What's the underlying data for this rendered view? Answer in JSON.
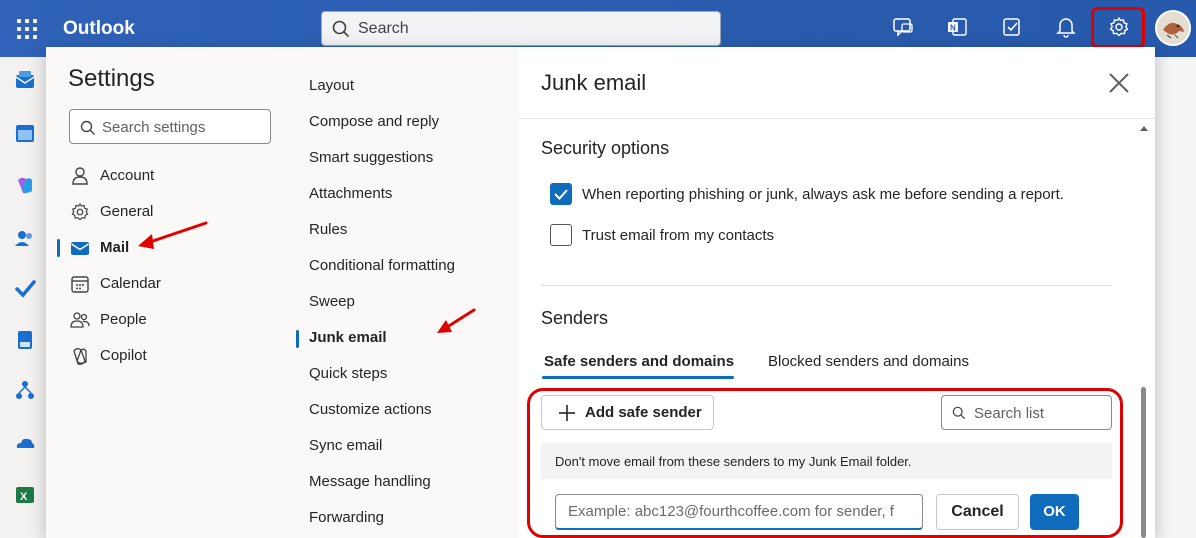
{
  "topbar": {
    "app_name": "Outlook",
    "search_placeholder": "Search"
  },
  "settings": {
    "title": "Settings",
    "search_placeholder": "Search settings",
    "categories": [
      {
        "label": "Account",
        "icon": "person-icon"
      },
      {
        "label": "General",
        "icon": "gear-icon"
      },
      {
        "label": "Mail",
        "icon": "mail-icon",
        "selected": true
      },
      {
        "label": "Calendar",
        "icon": "calendar-icon"
      },
      {
        "label": "People",
        "icon": "people-icon"
      },
      {
        "label": "Copilot",
        "icon": "copilot-icon"
      }
    ],
    "mail_subsections": [
      {
        "label": "Layout"
      },
      {
        "label": "Compose and reply"
      },
      {
        "label": "Smart suggestions"
      },
      {
        "label": "Attachments"
      },
      {
        "label": "Rules"
      },
      {
        "label": "Conditional formatting"
      },
      {
        "label": "Sweep"
      },
      {
        "label": "Junk email",
        "selected": true
      },
      {
        "label": "Quick steps"
      },
      {
        "label": "Customize actions"
      },
      {
        "label": "Sync email"
      },
      {
        "label": "Message handling"
      },
      {
        "label": "Forwarding"
      }
    ]
  },
  "junk": {
    "title": "Junk email",
    "security_heading": "Security options",
    "options": [
      {
        "label": "When reporting phishing or junk, always ask me before sending a report.",
        "checked": true
      },
      {
        "label": "Trust email from my contacts",
        "checked": false
      }
    ],
    "senders_heading": "Senders",
    "tabs": [
      {
        "label": "Safe senders and domains",
        "active": true
      },
      {
        "label": "Blocked senders and domains",
        "active": false
      }
    ],
    "add_button": "Add safe sender",
    "search_list_placeholder": "Search list",
    "info_text": "Don't move email from these senders to my Junk Email folder.",
    "email_placeholder": "Example: abc123@fourthcoffee.com for sender, f",
    "cancel_label": "Cancel",
    "ok_label": "OK"
  },
  "colors": {
    "accent": "#0f6cbd",
    "topbar": "#2c5fb3",
    "annotation": "#e00000"
  }
}
